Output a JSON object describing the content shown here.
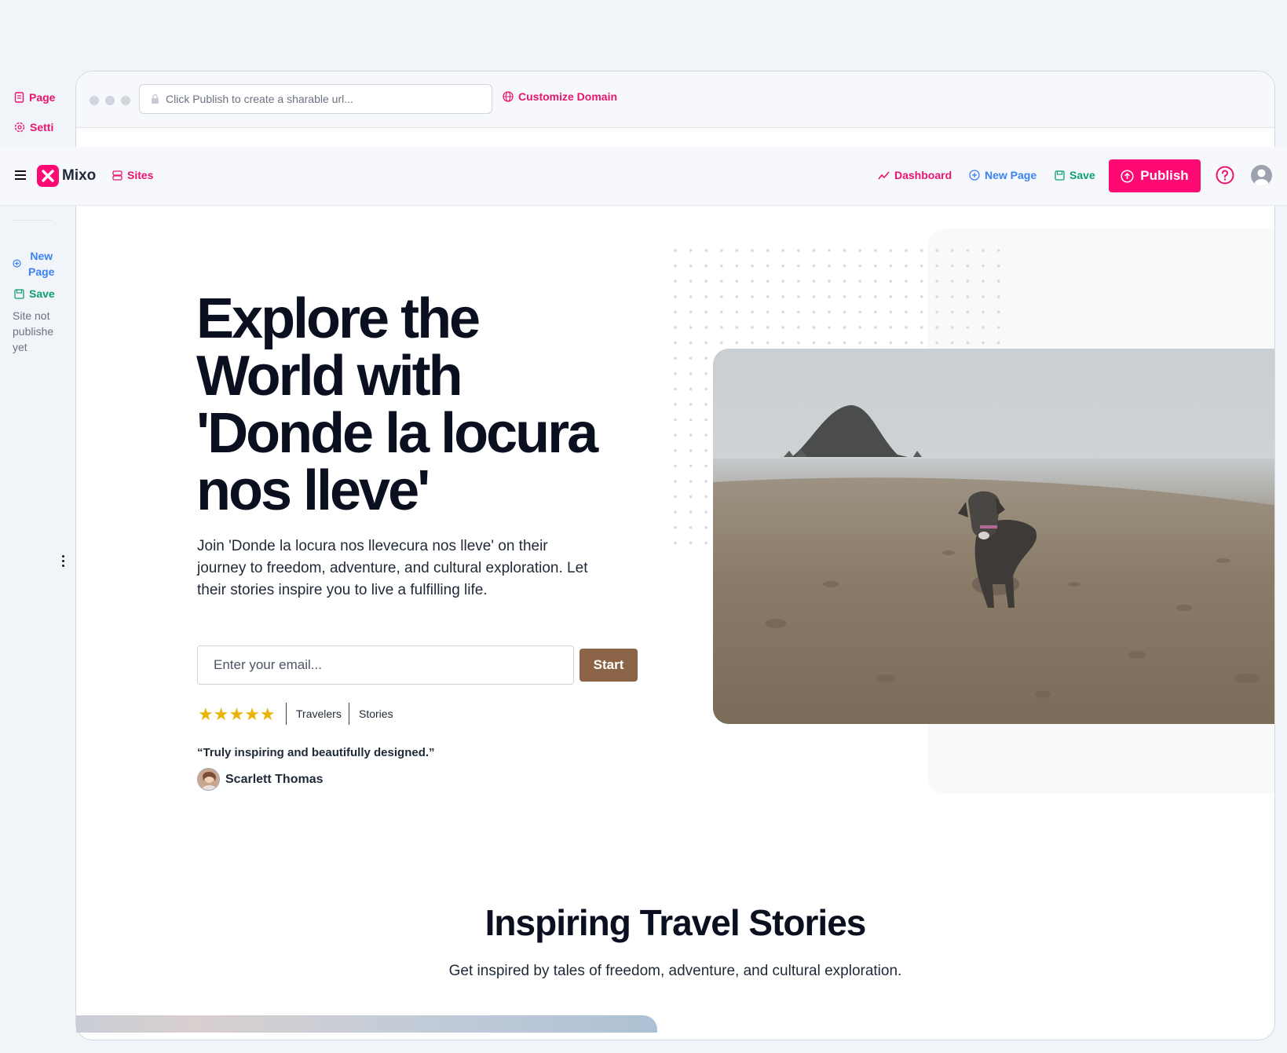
{
  "sidebar": {
    "page_label": "Page",
    "settings_label": "Setti",
    "new_page_label_1": "New",
    "new_page_label_2": "Page",
    "save_label": "Save",
    "status_1": "Site not",
    "status_2": "publishe",
    "status_3": "yet"
  },
  "browser": {
    "url_placeholder": "Click Publish to create a sharable url...",
    "customize_domain_label": "Customize Domain"
  },
  "nav": {
    "brand": "Mixo",
    "sites_label": "Sites",
    "dashboard_label": "Dashboard",
    "new_page_label": "New Page",
    "save_label": "Save",
    "publish_label": "Publish"
  },
  "hero": {
    "title": "Explore the World with 'Donde la locura nos lleve'",
    "subtitle": "Join 'Donde la locura nos llevecura nos lleve' on their journey to freedom, adventure, and cultural exploration. Let their stories inspire you to live a fulfilling life.",
    "email_placeholder": "Enter your email...",
    "cta_label": "Start",
    "stars": "★★★★★",
    "rating_label_1": "Travelers",
    "rating_label_2": "Stories",
    "quote": "“Truly inspiring and beautifully designed.”",
    "author": "Scarlett Thomas"
  },
  "stories": {
    "title": "Inspiring Travel Stories",
    "subtitle": "Get inspired by tales of freedom, adventure, and cultural exploration."
  },
  "colors": {
    "brand_pink": "#ff0a74",
    "link_blue": "#3b82f6",
    "save_green": "#0e9f6e",
    "cta_brown": "#8b6447",
    "star_yellow": "#eab308"
  },
  "icons": [
    "page-icon",
    "settings-icon",
    "globe-icon",
    "lock-icon",
    "menu-icon",
    "mixo-logo-icon",
    "sites-icon",
    "trend-icon",
    "plus-circle-icon",
    "save-icon",
    "upload-icon",
    "help-icon",
    "user-avatar-icon",
    "more-vertical-icon"
  ]
}
